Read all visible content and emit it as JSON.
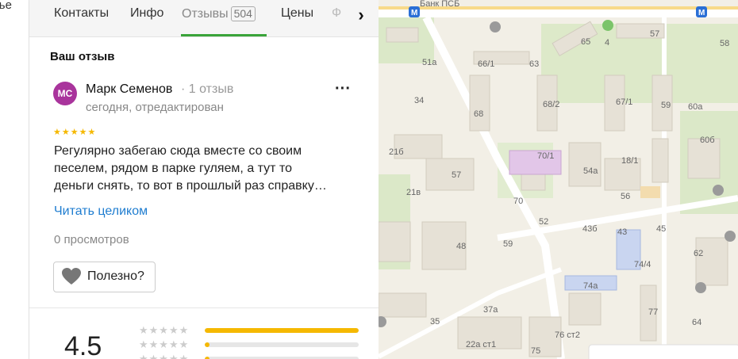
{
  "left_strip": {
    "cut_text": "лье"
  },
  "tabs": [
    {
      "label": "Контакты"
    },
    {
      "label": "Инфо"
    },
    {
      "label": "Отзывы",
      "count": "504",
      "active": true
    },
    {
      "label": "Цены"
    },
    {
      "label": "Ф"
    }
  ],
  "tab_next_icon": "chevron-right-icon",
  "review": {
    "section_title": "Ваш отзыв",
    "avatar_initials": "МС",
    "avatar_color": "#a9349c",
    "author": "Марк Семенов",
    "author_meta": "· 1 отзыв",
    "date": "сегодня, отредактирован",
    "stars": "★★★★★",
    "text_lines": [
      "Регулярно забегаю сюда вместе со своим",
      "песелем, рядом в парке гуляем, а тут то",
      "деньги снять, то вот в прошлый раз справку…"
    ],
    "read_more": "Читать целиком",
    "views": "0 просмотров",
    "useful_label": "Полезно?"
  },
  "summary": {
    "rating": "4.5",
    "distribution": [
      {
        "stars": 5,
        "fraction": 1.0
      },
      {
        "stars": 4,
        "fraction": 0.03
      },
      {
        "stars": 3,
        "fraction": 0.03
      }
    ]
  },
  "map": {
    "top_label": "Банк ПСБ",
    "buildings": [
      "65",
      "4",
      "57",
      "51а",
      "66/1",
      "63",
      "58",
      "34",
      "68",
      "68/2",
      "67/1",
      "59",
      "60а",
      "21б",
      "70/1",
      "60б",
      "18/1",
      "57",
      "54а",
      "21в",
      "56",
      "70",
      "52",
      "43б",
      "43",
      "45",
      "48",
      "59",
      "62",
      "74/4",
      "74а",
      "37а",
      "77",
      "35",
      "64",
      "22а ст1",
      "76 ст2",
      "75"
    ],
    "accent": "#f5b800",
    "active_tab_color": "#3aa43a",
    "link_color": "#1f7dd0"
  }
}
